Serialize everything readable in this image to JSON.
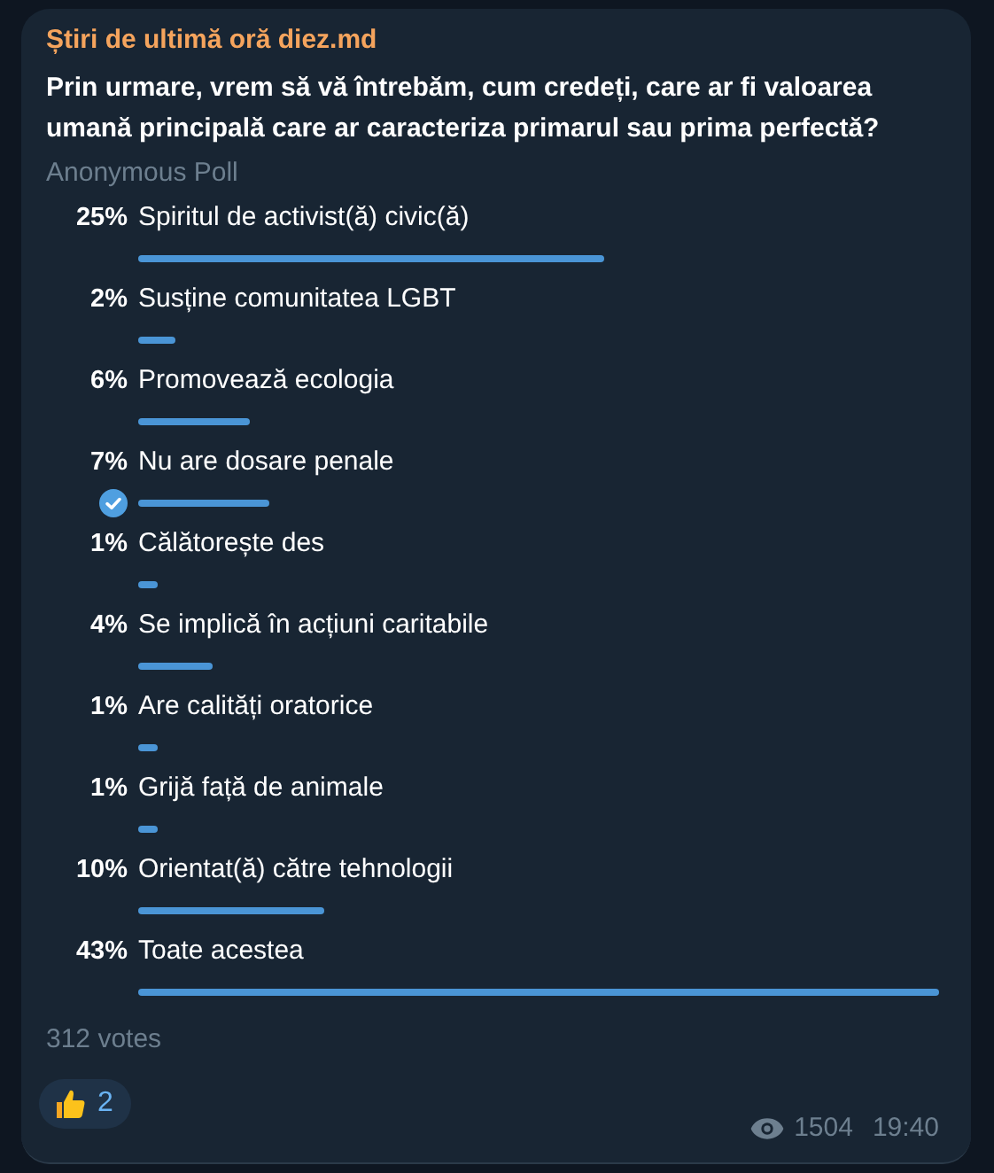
{
  "channel": {
    "name": "Știri de ultimă oră diez.md"
  },
  "poll": {
    "question": "Prin urmare, vrem să vă întrebăm, cum credeți, care ar fi valoarea umană principală care ar caracteriza primarul sau prima perfectă?",
    "type": "Anonymous Poll",
    "options": [
      {
        "percent": "25%",
        "label": "Spiritul de activist(ă) civic(ă)",
        "selected": false
      },
      {
        "percent": "2%",
        "label": "Susține comunitatea LGBT",
        "selected": false
      },
      {
        "percent": "6%",
        "label": "Promovează ecologia",
        "selected": false
      },
      {
        "percent": "7%",
        "label": "Nu are dosare penale",
        "selected": true
      },
      {
        "percent": "1%",
        "label": "Călătorește des",
        "selected": false
      },
      {
        "percent": "4%",
        "label": "Se implică în acțiuni caritabile",
        "selected": false
      },
      {
        "percent": "1%",
        "label": "Are calități oratorice",
        "selected": false
      },
      {
        "percent": "1%",
        "label": "Grijă față de animale",
        "selected": false
      },
      {
        "percent": "10%",
        "label": "Orientat(ă) către tehnologii",
        "selected": false
      },
      {
        "percent": "43%",
        "label": "Toate acestea",
        "selected": false
      }
    ],
    "votes": "312 votes"
  },
  "reaction": {
    "count": "2"
  },
  "footer": {
    "views": "1504",
    "time": "19:40"
  }
}
